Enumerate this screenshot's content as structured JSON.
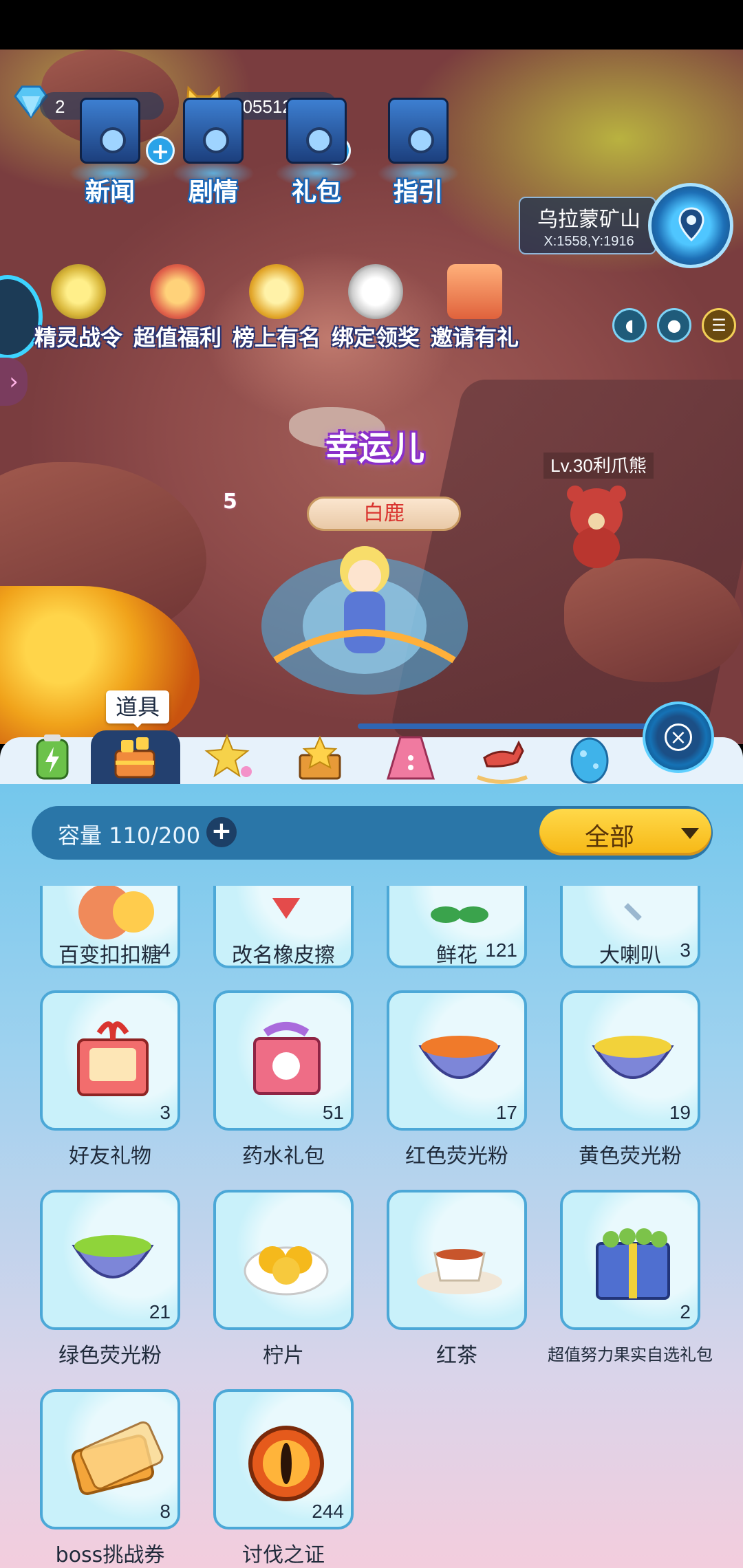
{
  "currency": {
    "gems": "2",
    "coins": "105512"
  },
  "top_menu": [
    {
      "label": "新闻",
      "icon": "news-icon"
    },
    {
      "label": "剧情",
      "icon": "story-icon"
    },
    {
      "label": "礼包",
      "icon": "gift-pack-icon"
    },
    {
      "label": "指引",
      "icon": "guide-icon"
    }
  ],
  "location": {
    "name": "乌拉蒙矿山",
    "coords": "X:1558,Y:1916"
  },
  "activities": [
    {
      "label": "精灵战令",
      "icon": "battle-pass-icon",
      "color": "#d8b63a"
    },
    {
      "label": "超值福利",
      "icon": "welfare-gift-icon",
      "color": "#e0604a"
    },
    {
      "label": "榜上有名",
      "icon": "trophy-icon",
      "color": "#e2a62a"
    },
    {
      "label": "绑定领奖",
      "icon": "panda-icon",
      "color": "#f2f2f2"
    },
    {
      "label": "邀请有礼",
      "icon": "invite-envelope-icon",
      "color": "#e0623c"
    }
  ],
  "scene": {
    "lucky_banner": "幸运儿",
    "player_name": "白鹿",
    "pet_level": "5",
    "enemy_name": "Lv.30利爪熊"
  },
  "bag": {
    "active_tab_tooltip": "道具",
    "tabs": [
      {
        "icon": "battery-icon",
        "color": "#6cc24a"
      },
      {
        "icon": "items-box-icon",
        "color": "#f08a3c"
      },
      {
        "icon": "stars-icon",
        "color": "#f6d24a"
      },
      {
        "icon": "star-box-icon",
        "color": "#e79a38"
      },
      {
        "icon": "dress-icon",
        "color": "#f07aa0"
      },
      {
        "icon": "rocking-horse-icon",
        "color": "#e05046"
      },
      {
        "icon": "egg-icon",
        "color": "#3fb3ea"
      }
    ],
    "capacity_label": "容量 110/200",
    "filter_label": "全部",
    "items": [
      {
        "name": "百变扣扣糖",
        "count": "4",
        "color": "#f08a5a"
      },
      {
        "name": "改名橡皮擦",
        "count": "",
        "color": "#e44b4b"
      },
      {
        "name": "鲜花",
        "count": "121",
        "color": "#3aa34c"
      },
      {
        "name": "大喇叭",
        "count": "3",
        "color": "#9ab7cf"
      },
      {
        "name": "好友礼物",
        "count": "3",
        "color": "#e75858"
      },
      {
        "name": "药水礼包",
        "count": "51",
        "color": "#ee6d86"
      },
      {
        "name": "红色荧光粉",
        "count": "17",
        "color": "#f07a2a"
      },
      {
        "name": "黄色荧光粉",
        "count": "19",
        "color": "#f2d23a"
      },
      {
        "name": "绿色荧光粉",
        "count": "21",
        "color": "#8fd43a"
      },
      {
        "name": "柠片",
        "count": "",
        "color": "#f5b91c"
      },
      {
        "name": "红茶",
        "count": "",
        "color": "#c8552c"
      },
      {
        "name": "超值努力果实自选礼包",
        "count": "2",
        "color": "#7cc34a"
      },
      {
        "name": "boss挑战券",
        "count": "8",
        "color": "#f4a53a"
      },
      {
        "name": "讨伐之证",
        "count": "244",
        "color": "#e55a1c"
      }
    ]
  }
}
